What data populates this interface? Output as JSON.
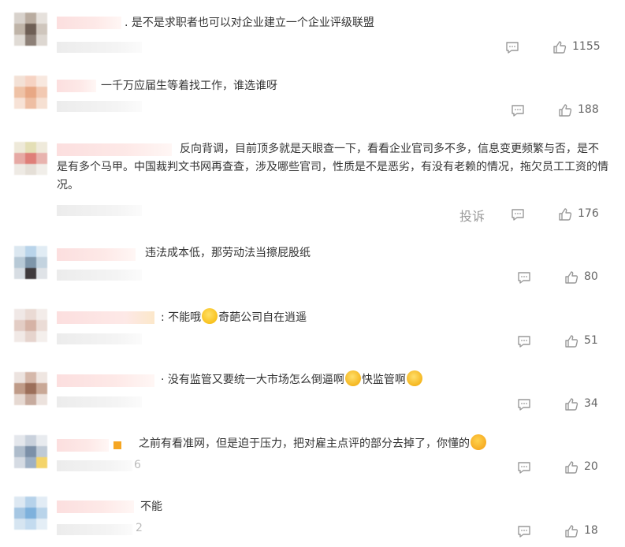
{
  "comments": [
    {
      "text": "是不是求职者也可以对企业建立一个企业评级联盟",
      "prefix": ".",
      "likes": "1155"
    },
    {
      "text": "一千万应届生等着找工作，谁选谁呀",
      "likes": "188"
    },
    {
      "text": "反向背调，目前顶多就是天眼查一下，看看企业官司多不多，信息变更频繁与否，是不是有多个马甲。中国裁判文书网再查查，涉及哪些官司，性质是不是恶劣，有没有老赖的情况，拖欠员工工资的情况。",
      "likes": "176",
      "report": "投诉"
    },
    {
      "text": "违法成本低，那劳动法当擦屁股纸",
      "likes": "80"
    },
    {
      "text_before": "不能哦",
      "text_after": "奇葩公司自在逍遥",
      "prefix": ":",
      "likes": "51"
    },
    {
      "text_before": "没有监管又要统一大市场怎么倒逼啊",
      "text_mid": "快监管啊",
      "prefix": "·",
      "likes": "34"
    },
    {
      "text": "之前有看准网，但是迫于压力，把对雇主点评的部分去掉了，你懂的",
      "likes": "20",
      "meta_char": "6"
    },
    {
      "text": "不能",
      "likes": "18",
      "meta_char": "2"
    }
  ],
  "icons": {
    "comment": "comment-icon",
    "like": "thumbs-up-icon"
  }
}
